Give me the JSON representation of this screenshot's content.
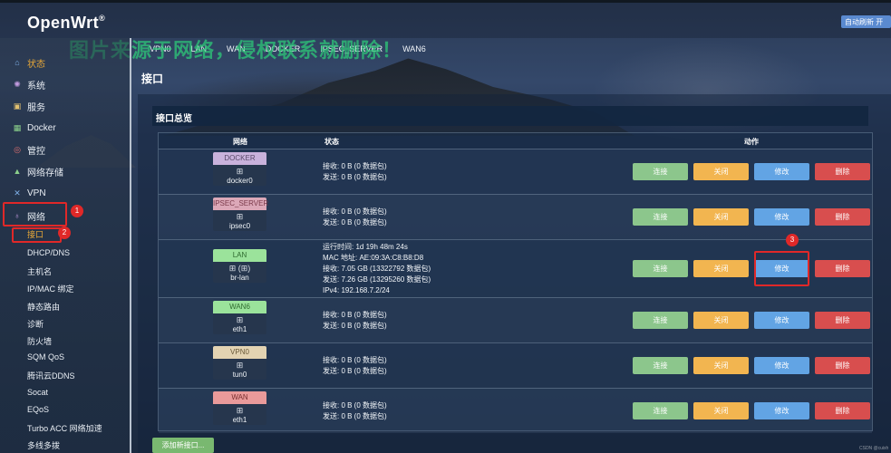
{
  "brand": {
    "name": "OpenWrt",
    "mark": "®"
  },
  "header": {
    "auto_refresh": "自动刷新 开"
  },
  "watermark": "图片来源于网络，侵权联系就删除！",
  "topnav": [
    "VPN0",
    "LAN",
    "WAN",
    "DOCKER",
    "IPSEC_SERVER",
    "WAN6"
  ],
  "sidebar": {
    "items": [
      {
        "label": "状态",
        "icon": "home-icon",
        "active": true
      },
      {
        "label": "系统",
        "icon": "gear-icon"
      },
      {
        "label": "服务",
        "icon": "services-icon"
      },
      {
        "label": "Docker",
        "icon": "docker-icon"
      },
      {
        "label": "管控",
        "icon": "control-icon"
      },
      {
        "label": "网络存储",
        "icon": "storage-icon"
      },
      {
        "label": "VPN",
        "icon": "vpn-icon"
      },
      {
        "label": "网络",
        "icon": "network-icon"
      }
    ],
    "sub_items": [
      "接口",
      "DHCP/DNS",
      "主机名",
      "IP/MAC 绑定",
      "静态路由",
      "诊断",
      "防火墙",
      "SQM QoS",
      "腾讯云DDNS",
      "Socat",
      "EQoS",
      "Turbo ACC 网络加速",
      "多线多拨"
    ]
  },
  "annotations": {
    "n1": "1",
    "n2": "2",
    "n3": "3"
  },
  "page": {
    "title": "接口",
    "section": "接口总览"
  },
  "table": {
    "headers": {
      "network": "网络",
      "status": "状态",
      "actions": "动作"
    },
    "actions": {
      "connect": "连接",
      "stop": "关闭",
      "edit": "修改",
      "delete": "删除"
    },
    "rows": [
      {
        "name": "DOCKER",
        "color": "#c9b2dc",
        "icon": "⊞",
        "device": "docker0",
        "status": [
          "接收: 0 B (0 数据包)",
          "发送: 0 B (0 数据包)"
        ]
      },
      {
        "name": "IPSEC_SERVER",
        "color": "#dca8b8",
        "icon": "⊞",
        "device": "ipsec0",
        "status": [
          "接收: 0 B (0 数据包)",
          "发送: 0 B (0 数据包)"
        ]
      },
      {
        "name": "LAN",
        "color": "#9be39b",
        "icon": "⊞ (⊞)",
        "device": "br-lan",
        "status": [
          "运行时间: 1d 19h 48m 24s",
          "MAC 地址: AE:09:3A:C8:B8:D8",
          "接收: 7.05 GB (13322792 数据包)",
          "发送: 7.26 GB (13295260 数据包)",
          "IPv4: 192.168.7.2/24"
        ]
      },
      {
        "name": "WAN6",
        "color": "#9be39b",
        "icon": "⊞",
        "device": "eth1",
        "status": [
          "接收: 0 B (0 数据包)",
          "发送: 0 B (0 数据包)"
        ]
      },
      {
        "name": "VPN0",
        "color": "#e3d3b2",
        "icon": "⊞",
        "device": "tun0",
        "status": [
          "接收: 0 B (0 数据包)",
          "发送: 0 B (0 数据包)"
        ]
      },
      {
        "name": "WAN",
        "color": "#e99a9a",
        "icon": "⊞",
        "device": "eth1",
        "status": [
          "接收: 0 B (0 数据包)",
          "发送: 0 B (0 数据包)"
        ]
      }
    ]
  },
  "add_button": "添加新接口...",
  "corner_mark": "CSDN @cuixh"
}
